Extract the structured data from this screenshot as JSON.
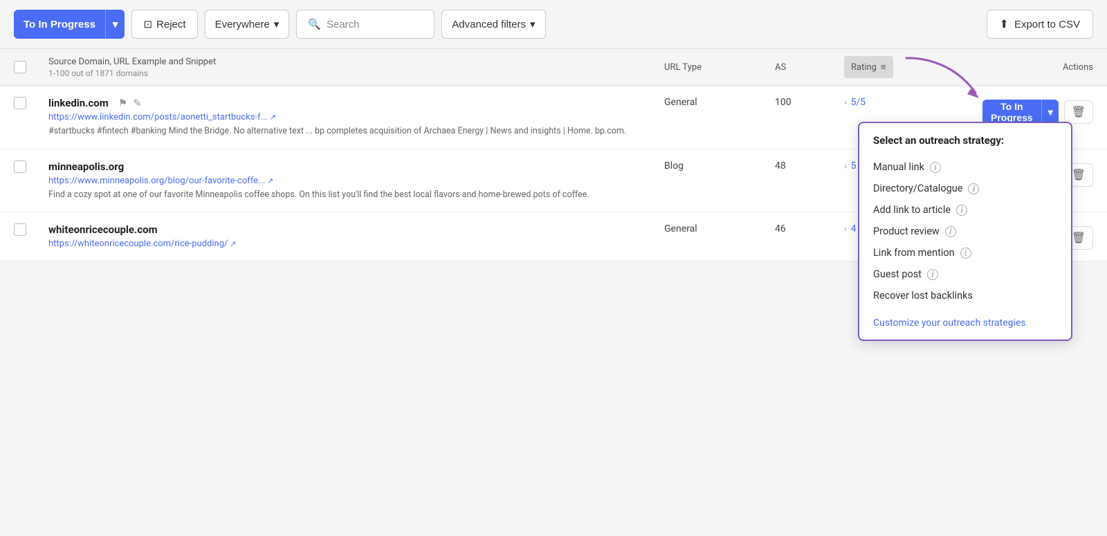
{
  "toolbar": {
    "to_in_progress_label": "To In Progress",
    "reject_label": "Reject",
    "everywhere_label": "Everywhere",
    "search_placeholder": "Search",
    "advanced_filters_label": "Advanced filters",
    "export_label": "Export to CSV"
  },
  "table": {
    "header": {
      "source_col": "Source Domain, URL Example and Snippet",
      "subtext": "1-100 out of 1871 domains",
      "urltype_col": "URL Type",
      "as_col": "AS",
      "rating_col": "Rating",
      "actions_col": "Actions"
    },
    "rows": [
      {
        "domain": "linkedin.com",
        "url": "https://www.linkedin.com/posts/aonetti_startbucks-f...",
        "snippet": "#startbucks #fintech #banking Mind the Bridge. No alternative text ... bp completes acquisition of Archaea Energy | News and insights | Home. bp.com.",
        "url_type": "General",
        "as": "100",
        "rating": "5/5",
        "show_dropdown": true
      },
      {
        "domain": "minneapolis.org",
        "url": "https://www.minneapolis.org/blog/our-favorite-coffe...",
        "snippet": "Find a cozy spot at one of our favorite Minneapolis coffee shops. On this list you'll find the best local flavors and home-brewed pots of coffee.",
        "url_type": "Blog",
        "as": "48",
        "rating": "5",
        "show_dropdown": false
      },
      {
        "domain": "whiteonricecouple.com",
        "url": "https://whiteonricecouple.com/rice-pudding/",
        "snippet": "",
        "url_type": "General",
        "as": "46",
        "rating": "4",
        "show_dropdown": false
      }
    ]
  },
  "outreach_dropdown": {
    "title": "Select an outreach strategy:",
    "items": [
      {
        "label": "Manual link",
        "has_info": true
      },
      {
        "label": "Directory/Catalogue",
        "has_info": true
      },
      {
        "label": "Add link to article",
        "has_info": true
      },
      {
        "label": "Product review",
        "has_info": true
      },
      {
        "label": "Link from mention",
        "has_info": true
      },
      {
        "label": "Guest post",
        "has_info": true
      },
      {
        "label": "Recover lost backlinks",
        "has_info": false
      }
    ],
    "customize_link": "Customize your outreach strategies"
  },
  "buttons": {
    "to_in_progress": "To In Progress",
    "delete_icon": "🗑"
  }
}
